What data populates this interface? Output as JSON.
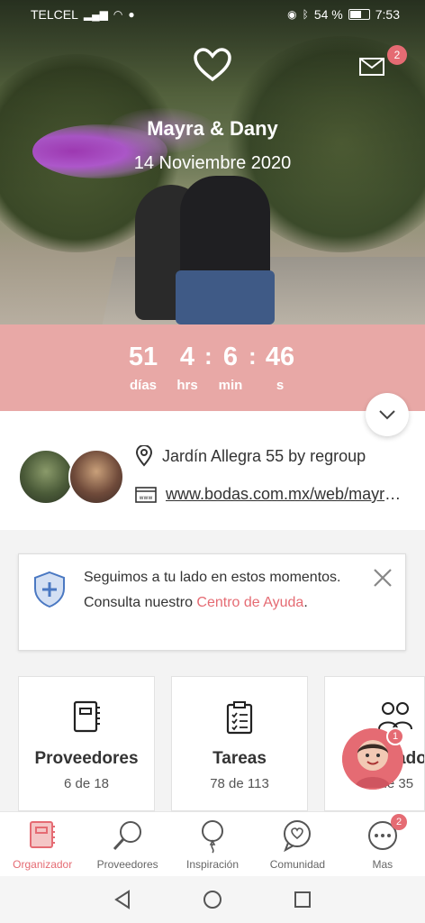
{
  "status_bar": {
    "carrier": "TELCEL",
    "battery": "54 %",
    "time": "7:53"
  },
  "header": {
    "couple": "Mayra & Dany",
    "date": "14 Noviembre 2020",
    "mail_badge": "2"
  },
  "countdown": [
    {
      "value": "51",
      "label": "días"
    },
    {
      "value": "4",
      "label": "hrs"
    },
    {
      "value": "6",
      "label": "min"
    },
    {
      "value": "46",
      "label": "s"
    }
  ],
  "info": {
    "venue": "Jardín Allegra 55 by regroup",
    "website": "www.bodas.com.mx/web/mayra-y-dany"
  },
  "help_card": {
    "text": "Seguimos a tu lado en estos momentos. Consulta nuestro ",
    "link": "Centro de Ayuda",
    "end": "."
  },
  "tools": [
    {
      "title": "Proveedores",
      "sub": "6 de 18"
    },
    {
      "title": "Tareas",
      "sub": "78 de 113"
    },
    {
      "title": "Invitados",
      "sub": "0 de 35"
    }
  ],
  "chat_badge": "1",
  "bottom_nav": [
    {
      "label": "Organizador"
    },
    {
      "label": "Proveedores"
    },
    {
      "label": "Inspiración"
    },
    {
      "label": "Comunidad"
    },
    {
      "label": "Mas"
    }
  ],
  "nav_badge": "2",
  "colors": {
    "accent": "#e56b73",
    "countdown_bg": "#e8a8a6"
  }
}
